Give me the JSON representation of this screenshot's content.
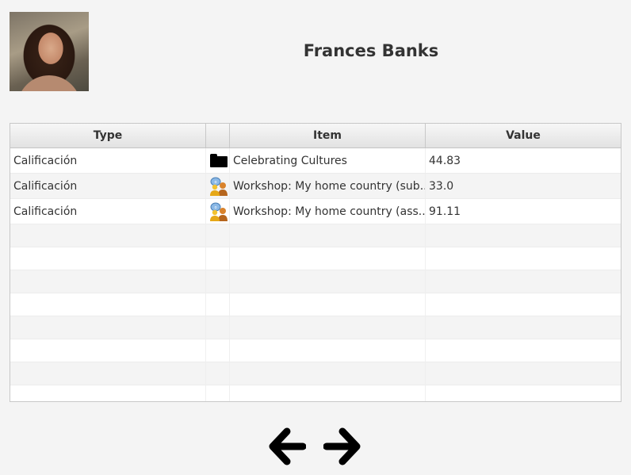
{
  "user": {
    "name": "Frances Banks"
  },
  "table": {
    "headers": {
      "type": "Type",
      "icon": "",
      "item": "Item",
      "value": "Value"
    },
    "rows": [
      {
        "type": "Calificación",
        "icon": "folder-icon",
        "item": "Celebrating Cultures",
        "value": "44.83"
      },
      {
        "type": "Calificación",
        "icon": "workshop-icon",
        "item": "Workshop: My home country (sub...",
        "value": "33.0"
      },
      {
        "type": "Calificación",
        "icon": "workshop-icon",
        "item": "Workshop: My home country (ass...",
        "value": "91.11"
      }
    ]
  },
  "nav": {
    "prev_icon": "arrow-left-icon",
    "next_icon": "arrow-right-icon"
  }
}
